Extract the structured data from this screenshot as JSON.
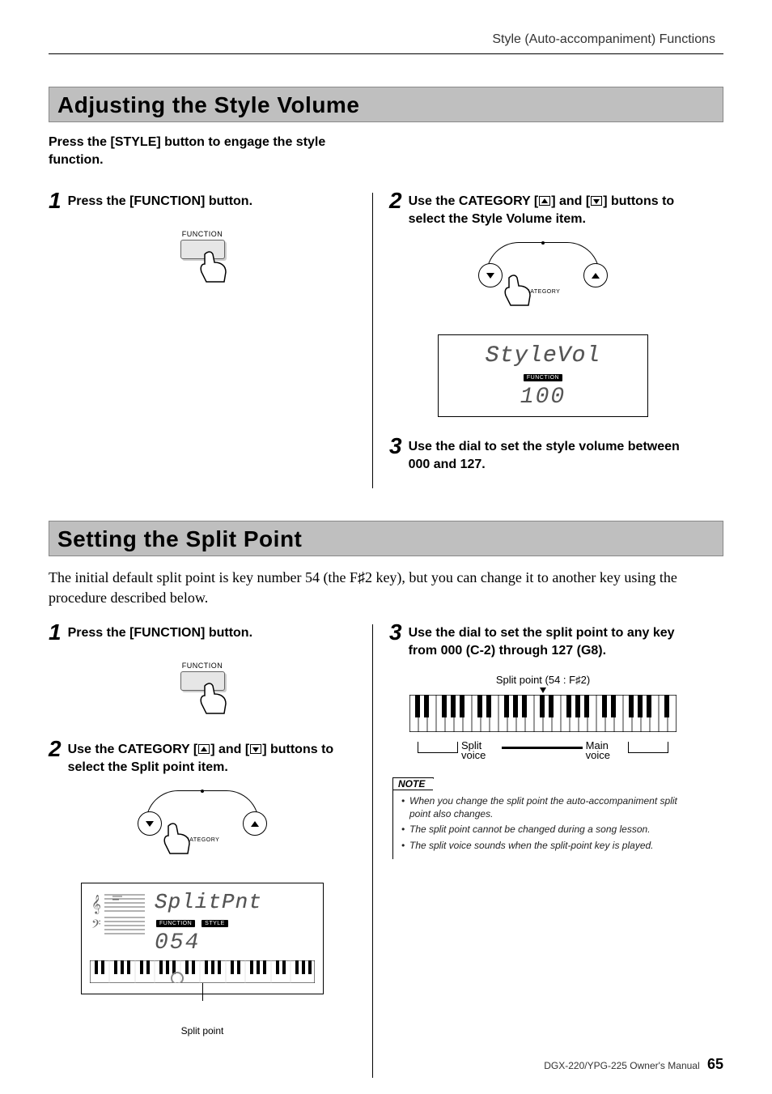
{
  "running_head": "Style (Auto-accompaniment) Functions",
  "section1": {
    "title": "Adjusting the Style Volume",
    "lead": "Press the [STYLE] button to engage the style function.",
    "steps": {
      "s1": {
        "num": "1",
        "text": "Press the [FUNCTION] button."
      },
      "s2": {
        "num": "2",
        "text_a": "Use the CATEGORY [",
        "text_b": "] and [",
        "text_c": "] buttons to select the Style Volume item."
      },
      "s3": {
        "num": "3",
        "text": "Use the dial to set the style volume between 000 and 127."
      }
    },
    "illus": {
      "function_label": "FUNCTION",
      "category_label": "CATEGORY",
      "lcd_title": "StyleVol",
      "lcd_badge": "FUNCTION",
      "lcd_value": "100"
    }
  },
  "section2": {
    "title": "Setting the Split Point",
    "body": "The initial default split point is key number 54 (the F♯2 key), but you can change it to another key using the procedure described below.",
    "steps": {
      "s1": {
        "num": "1",
        "text": "Press the [FUNCTION] button."
      },
      "s2": {
        "num": "2",
        "text_a": "Use the CATEGORY [",
        "text_b": "] and [",
        "text_c": "] buttons to select the Split point item."
      },
      "s3": {
        "num": "3",
        "text": "Use the dial to set the split point to any key from 000 (C-2) through 127 (G8)."
      }
    },
    "illus": {
      "function_label": "FUNCTION",
      "category_label": "CATEGORY",
      "lcd_title": "SplitPnt",
      "lcd_badge1": "FUNCTION",
      "lcd_badge2": "STYLE",
      "lcd_value": "054",
      "callout": "Split point",
      "kbd_top": "Split point (54 : F♯2)",
      "kbd_left": "Split voice",
      "kbd_right": "Main voice"
    },
    "note": {
      "head": "NOTE",
      "items": [
        "When you change the split point the auto-accompaniment split point also changes.",
        "The split point cannot be changed during a song lesson.",
        "The split voice sounds when the split-point key is played."
      ]
    }
  },
  "footer": {
    "manual": "DGX-220/YPG-225  Owner's Manual",
    "page": "65"
  }
}
